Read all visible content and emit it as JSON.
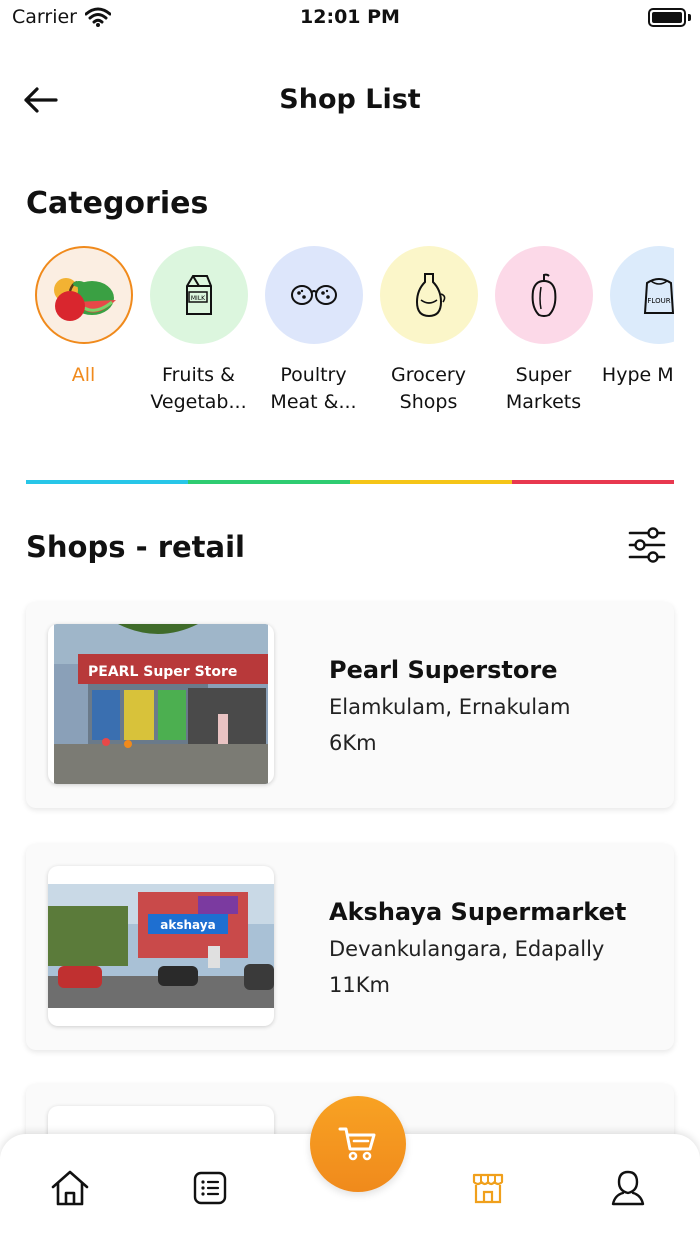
{
  "status": {
    "carrier": "Carrier",
    "time": "12:01 PM"
  },
  "header": {
    "title": "Shop List"
  },
  "categories": {
    "heading": "Categories",
    "items": [
      {
        "label": "All",
        "icon": "fruits-vegetables-icon",
        "color": "#fbeee2",
        "active": true
      },
      {
        "label": "Fruits & Vegetab...",
        "icon": "milk-carton-icon",
        "color": "#dcf6de"
      },
      {
        "label": "Poultry Meat &...",
        "icon": "meat-icon",
        "color": "#dde6fb"
      },
      {
        "label": "Grocery Shops",
        "icon": "oil-bottle-icon",
        "color": "#fbf6c9"
      },
      {
        "label": "Super Markets",
        "icon": "pepper-icon",
        "color": "#fcd9e8"
      },
      {
        "label": "Hype Marke",
        "icon": "flour-bag-icon",
        "color": "#dcebfb"
      }
    ]
  },
  "divider_colors": [
    "#27c6e8",
    "#2ecc71",
    "#f5c518",
    "#e8384f"
  ],
  "shops": {
    "heading": "Shops - retail",
    "items": [
      {
        "name": "Pearl Superstore",
        "location": "Elamkulam, Ernakulam",
        "distance": "6Km",
        "sign": "PEARL  Super Store"
      },
      {
        "name": "Akshaya Supermarket",
        "location": "Devankulangara, Edapally",
        "distance": "11Km",
        "sign": "akshaya"
      }
    ]
  },
  "tabbar": {
    "accent": "#f08a1c",
    "items": [
      {
        "icon": "home-icon"
      },
      {
        "icon": "list-icon"
      },
      {
        "icon": "cart-icon"
      },
      {
        "icon": "store-icon",
        "active": true
      },
      {
        "icon": "profile-icon"
      }
    ]
  }
}
